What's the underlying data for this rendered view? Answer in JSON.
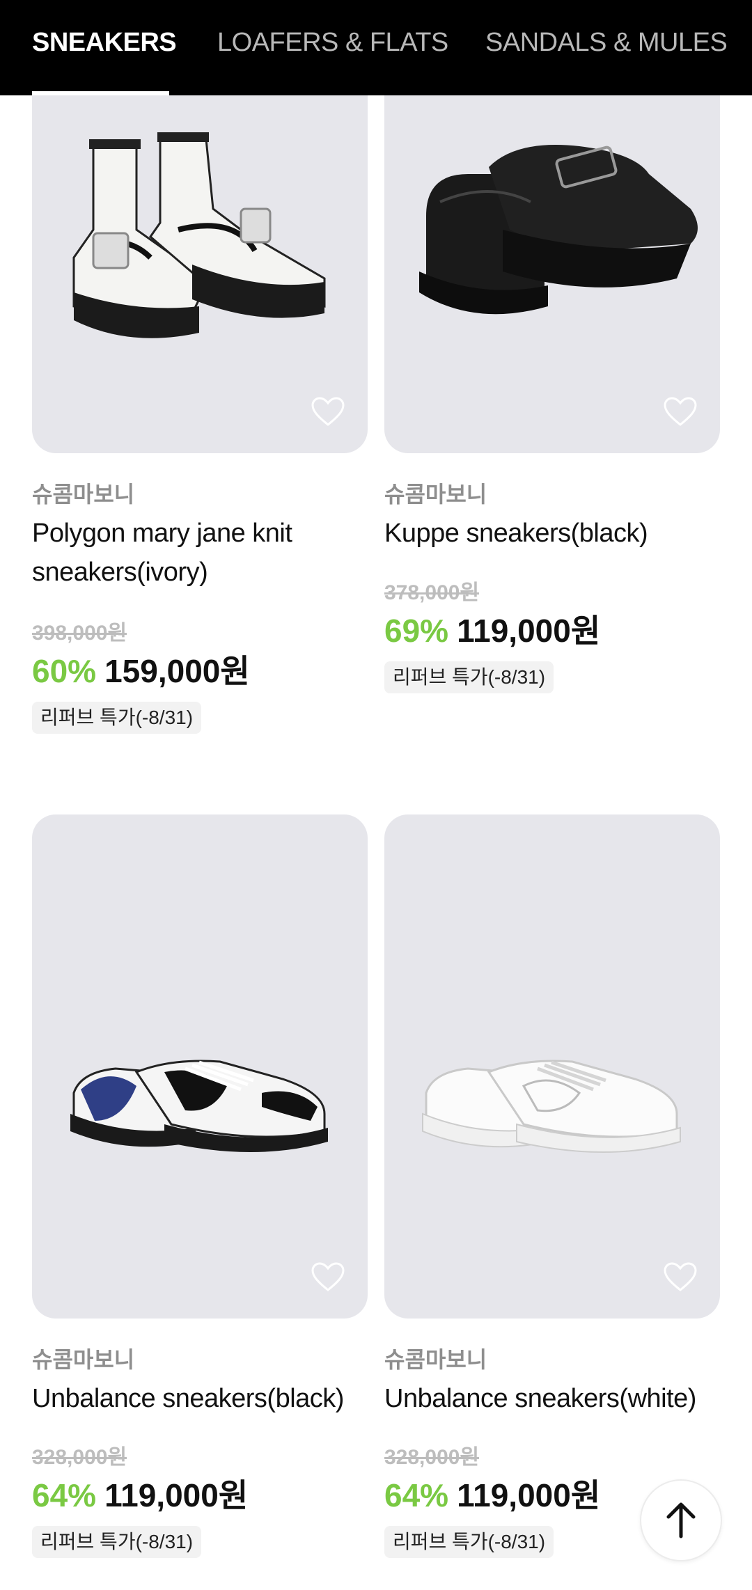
{
  "tabs": [
    {
      "label": "SNEAKERS",
      "active": true
    },
    {
      "label": "LOAFERS & FLATS",
      "active": false
    },
    {
      "label": "SANDALS & MULES",
      "active": false
    }
  ],
  "products": [
    {
      "brand": "슈콤마보니",
      "name": "Polygon mary jane knit sneakers(ivory)",
      "original_price": "398,000원",
      "discount": "60%",
      "price": "159,000원",
      "badge": "리퍼브 특가(-8/31)",
      "image": "ivory-knit-mary-jane-sneaker"
    },
    {
      "brand": "슈콤마보니",
      "name": "Kuppe sneakers(black)",
      "original_price": "378,000원",
      "discount": "69%",
      "price": "119,000원",
      "badge": "리퍼브 특가(-8/31)",
      "image": "black-buckle-platform-sneaker"
    },
    {
      "brand": "슈콤마보니",
      "name": "Unbalance sneakers(black)",
      "original_price": "328,000원",
      "discount": "64%",
      "price": "119,000원",
      "badge": "리퍼브 특가(-8/31)",
      "image": "black-white-heart-sneaker"
    },
    {
      "brand": "슈콤마보니",
      "name": "Unbalance sneakers(white)",
      "original_price": "328,000원",
      "discount": "64%",
      "price": "119,000원",
      "badge": "리퍼브 특가(-8/31)",
      "image": "white-heart-sneaker"
    }
  ],
  "icons": {
    "wishlist": "heart-outline-icon",
    "scroll_top": "arrow-up-icon"
  },
  "colors": {
    "discount": "#7ac943",
    "image_bg": "#e6e6eb",
    "header_bg": "#000000"
  }
}
